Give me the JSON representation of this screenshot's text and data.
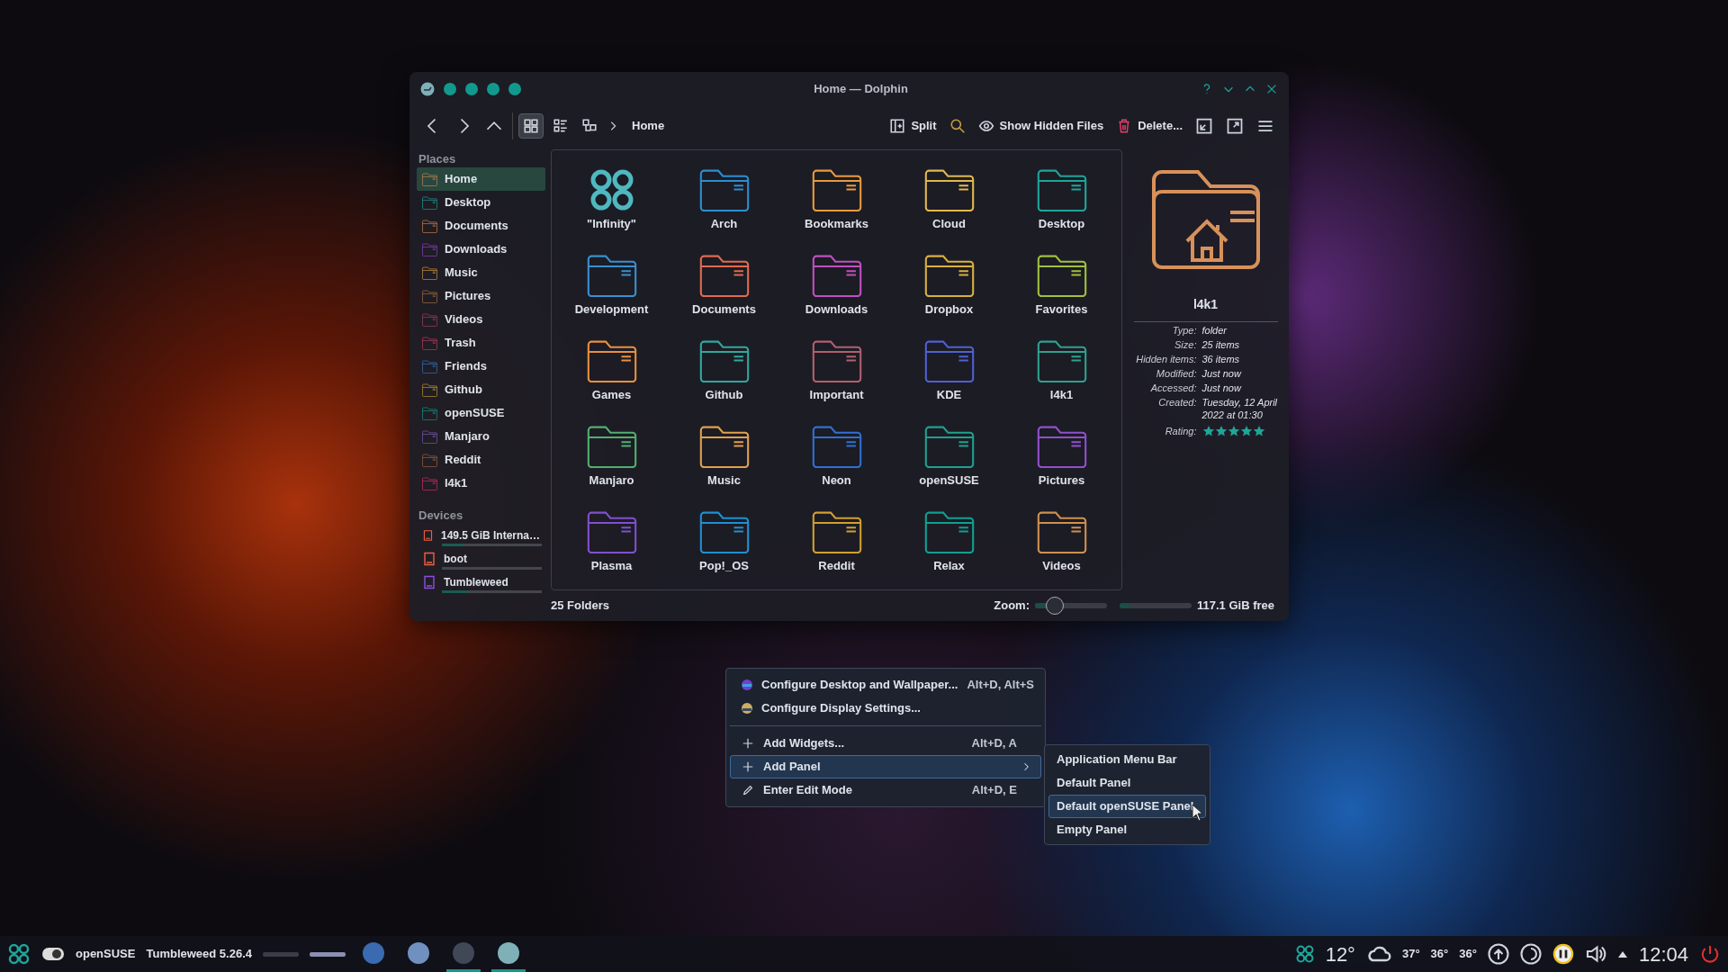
{
  "window": {
    "title": "Home — Dolphin"
  },
  "toolbar": {
    "view_modes": [
      {
        "selected": true
      },
      {
        "selected": false
      },
      {
        "selected": false
      }
    ],
    "breadcrumb": "Home",
    "actions": [
      {
        "label": "Split"
      },
      {
        "label": "Show Hidden Files"
      },
      {
        "label": "Delete..."
      }
    ]
  },
  "places": {
    "title": "Places",
    "items": [
      {
        "label": "Home",
        "selected": true
      },
      {
        "label": "Desktop",
        "selected": false
      },
      {
        "label": "Documents",
        "selected": false
      },
      {
        "label": "Downloads",
        "selected": false
      },
      {
        "label": "Music",
        "selected": false
      },
      {
        "label": "Pictures",
        "selected": false
      },
      {
        "label": "Videos",
        "selected": false
      },
      {
        "label": "Trash",
        "selected": false
      },
      {
        "label": "Friends",
        "selected": false
      },
      {
        "label": "Github",
        "selected": false
      },
      {
        "label": "openSUSE",
        "selected": false
      },
      {
        "label": "Manjaro",
        "selected": false
      },
      {
        "label": "Reddit",
        "selected": false
      },
      {
        "label": "l4k1",
        "selected": false
      }
    ]
  },
  "devices": {
    "title": "Devices",
    "items": [
      {
        "label": "149.5 GiB Interna…",
        "level": 0.22
      },
      {
        "label": "boot",
        "level": 0.02
      },
      {
        "label": "Tumbleweed",
        "level": 0.25
      }
    ]
  },
  "folders": [
    {
      "name": "\"Infinity\"",
      "kind": "logo"
    },
    {
      "name": "Arch",
      "kind": "folder"
    },
    {
      "name": "Bookmarks",
      "kind": "folder"
    },
    {
      "name": "Cloud",
      "kind": "folder"
    },
    {
      "name": "Desktop",
      "kind": "folder"
    },
    {
      "name": "Development",
      "kind": "folder"
    },
    {
      "name": "Documents",
      "kind": "folder"
    },
    {
      "name": "Downloads",
      "kind": "folder"
    },
    {
      "name": "Dropbox",
      "kind": "folder"
    },
    {
      "name": "Favorites",
      "kind": "folder"
    },
    {
      "name": "Games",
      "kind": "folder"
    },
    {
      "name": "Github",
      "kind": "folder"
    },
    {
      "name": "Important",
      "kind": "folder"
    },
    {
      "name": "KDE",
      "kind": "folder"
    },
    {
      "name": "l4k1",
      "kind": "folder"
    },
    {
      "name": "Manjaro",
      "kind": "folder"
    },
    {
      "name": "Music",
      "kind": "folder"
    },
    {
      "name": "Neon",
      "kind": "folder"
    },
    {
      "name": "openSUSE",
      "kind": "folder"
    },
    {
      "name": "Pictures",
      "kind": "folder"
    },
    {
      "name": "Plasma",
      "kind": "folder"
    },
    {
      "name": "Pop!_OS",
      "kind": "folder"
    },
    {
      "name": "Reddit",
      "kind": "folder"
    },
    {
      "name": "Relax",
      "kind": "folder"
    },
    {
      "name": "Videos",
      "kind": "folder"
    }
  ],
  "info": {
    "name": "l4k1",
    "properties": [
      {
        "label": "Type:",
        "value": "folder"
      },
      {
        "label": "Size:",
        "value": "25 items"
      },
      {
        "label": "Hidden items:",
        "value": "36 items"
      },
      {
        "label": "Modified:",
        "value": "Just now"
      },
      {
        "label": "Accessed:",
        "value": "Just now"
      },
      {
        "label": "Created:",
        "value": "Tuesday, 12 April 2022 at 01:30"
      }
    ],
    "rating": {
      "label": "Rating:",
      "stars": 5
    }
  },
  "status_bar": {
    "count": "25 Folders",
    "zoom_label": "Zoom:",
    "zoom": {
      "level": 0.2
    },
    "disk": {
      "level": 0.15
    },
    "free": "117.1 GiB free"
  },
  "context_menu": {
    "items": [
      {
        "kind": "item",
        "label": "Configure Desktop and Wallpaper...",
        "shortcut": "Alt+D, Alt+S",
        "selected": false
      },
      {
        "kind": "item",
        "label": "Configure Display Settings...",
        "selected": false
      },
      {
        "kind": "separator"
      },
      {
        "kind": "item",
        "label": "Add Widgets...",
        "shortcut": "Alt+D, A",
        "selected": false
      },
      {
        "kind": "submenu",
        "label": "Add Panel",
        "selected": true
      },
      {
        "kind": "item",
        "label": "Enter Edit Mode",
        "shortcut": "Alt+D, E",
        "selected": false
      }
    ]
  },
  "submenu": {
    "items": [
      {
        "label": "Application Menu Bar",
        "selected": false
      },
      {
        "label": "Default Panel",
        "selected": false
      },
      {
        "label": "Default openSUSE Panel",
        "selected": true
      },
      {
        "label": "Empty Panel",
        "selected": false
      }
    ]
  },
  "taskbar": {
    "distro": "openSUSE",
    "version": "Tumbleweed 5.26.4",
    "desktops": [
      {
        "selected": false
      },
      {
        "selected": true
      }
    ],
    "tasks": [
      {
        "active": false
      },
      {
        "active": false
      },
      {
        "active": true
      },
      {
        "active": true
      }
    ],
    "weather": "12°",
    "temps": [
      "37°",
      "36°",
      "36°"
    ],
    "clock": "12:04"
  }
}
